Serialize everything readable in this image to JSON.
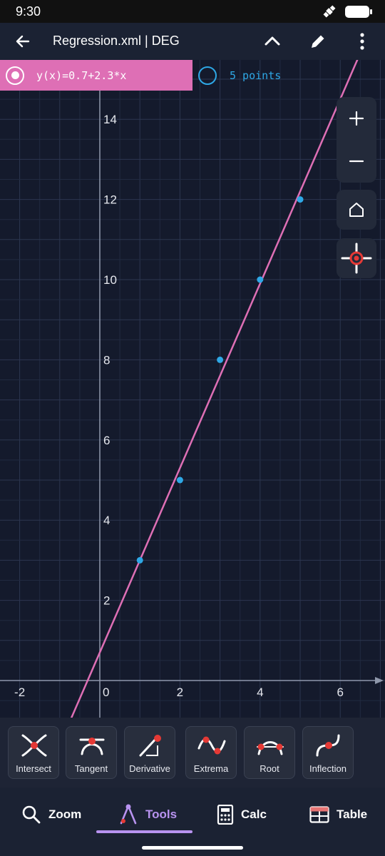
{
  "status": {
    "time": "9:30"
  },
  "appbar": {
    "title": "Regression.xml | DEG"
  },
  "function": {
    "label": "y(x)=0.7+2.3*x",
    "color": "#de6fb5"
  },
  "points_label": "5 points",
  "colors": {
    "background": "#141a2c",
    "accent": "#b893f0",
    "point": "#2ea8e6"
  },
  "chart_data": {
    "type": "scatter",
    "x": [
      1,
      2,
      3,
      4,
      5
    ],
    "y": [
      3,
      5,
      8,
      10,
      12
    ],
    "line": {
      "intercept": 0.7,
      "slope": 2.3
    },
    "xlim": [
      -2.5,
      7
    ],
    "ylim": [
      -1.5,
      14
    ],
    "x_ticks": [
      "-2",
      "0",
      "2",
      "4",
      "6"
    ],
    "y_ticks": [
      "2",
      "4",
      "6",
      "8",
      "10",
      "12",
      "14"
    ],
    "grid": true
  },
  "tools": [
    {
      "label": "Intersect",
      "icon": "intersect-icon"
    },
    {
      "label": "Tangent",
      "icon": "tangent-icon"
    },
    {
      "label": "Derivative",
      "icon": "derivative-icon"
    },
    {
      "label": "Extrema",
      "icon": "extrema-icon"
    },
    {
      "label": "Root",
      "icon": "root-icon"
    },
    {
      "label": "Inflection",
      "icon": "inflection-icon"
    }
  ],
  "nav": [
    {
      "label": "Zoom",
      "icon": "search-icon"
    },
    {
      "label": "Tools",
      "icon": "tools-icon",
      "active": true
    },
    {
      "label": "Calc",
      "icon": "calculator-icon"
    },
    {
      "label": "Table",
      "icon": "table-icon"
    }
  ]
}
